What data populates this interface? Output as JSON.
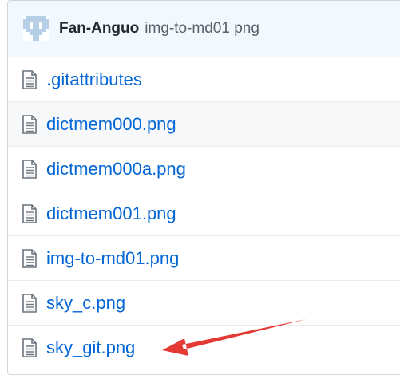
{
  "commit": {
    "author": "Fan-Anguo",
    "message": "img-to-md01 png"
  },
  "files": [
    {
      "name": ".gitattributes"
    },
    {
      "name": "dictmem000.png"
    },
    {
      "name": "dictmem000a.png"
    },
    {
      "name": "dictmem001.png"
    },
    {
      "name": "img-to-md01.png"
    },
    {
      "name": "sky_c.png"
    },
    {
      "name": "sky_git.png"
    }
  ],
  "annotation": {
    "arrow_color": "#e53935",
    "points_to": "sky_git.png"
  }
}
